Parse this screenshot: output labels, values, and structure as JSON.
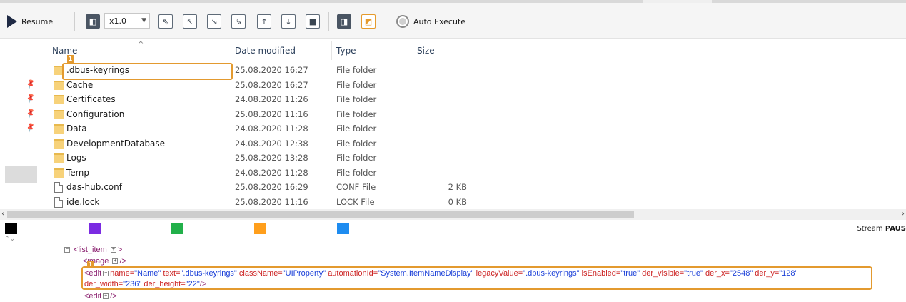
{
  "toolbar": {
    "resume_label": "Resume",
    "speed_value": "x1.0",
    "auto_execute_label": "Auto Execute"
  },
  "explorer": {
    "columns": {
      "name": "Name",
      "date": "Date modified",
      "type": "Type",
      "size": "Size"
    },
    "rows": [
      {
        "name": ".dbus-keyrings",
        "date": "25.08.2020 16:27",
        "type": "File folder",
        "size": "",
        "kind": "folder"
      },
      {
        "name": "Cache",
        "date": "25.08.2020 16:27",
        "type": "File folder",
        "size": "",
        "kind": "folder"
      },
      {
        "name": "Certificates",
        "date": "24.08.2020 11:26",
        "type": "File folder",
        "size": "",
        "kind": "folder"
      },
      {
        "name": "Configuration",
        "date": "25.08.2020 11:16",
        "type": "File folder",
        "size": "",
        "kind": "folder"
      },
      {
        "name": "Data",
        "date": "24.08.2020 11:28",
        "type": "File folder",
        "size": "",
        "kind": "folder"
      },
      {
        "name": "DevelopmentDatabase",
        "date": "24.08.2020 12:38",
        "type": "File folder",
        "size": "",
        "kind": "folder"
      },
      {
        "name": "Logs",
        "date": "25.08.2020 13:28",
        "type": "File folder",
        "size": "",
        "kind": "folder"
      },
      {
        "name": "Temp",
        "date": "24.08.2020 11:28",
        "type": "File folder",
        "size": "",
        "kind": "folder"
      },
      {
        "name": "das-hub.conf",
        "date": "25.08.2020 16:29",
        "type": "CONF File",
        "size": "2 KB",
        "kind": "file"
      },
      {
        "name": "ide.lock",
        "date": "25.08.2020 11:16",
        "type": "LOCK File",
        "size": "0 KB",
        "kind": "file"
      }
    ],
    "highlight_badge": "1"
  },
  "color_strip": {
    "swatches": [
      "#000000",
      "#7b2be2",
      "#22b04a",
      "#ff9f1c",
      "#1e8cf0"
    ],
    "stream_label": "Stream",
    "stream_state": "PAUS"
  },
  "xml": {
    "line1_tag": "<list_item",
    "line1_end": ">",
    "line2_tag": "<image",
    "line2_end": "/>",
    "line3_tag": "<edit",
    "line3_attrs": [
      {
        "n": "name=",
        "v": "\"Name\""
      },
      {
        "n": "text=",
        "v": "\".dbus-keyrings\""
      },
      {
        "n": "className=",
        "v": "\"UIProperty\""
      },
      {
        "n": "automationId=",
        "v": "\"System.ItemNameDisplay\""
      },
      {
        "n": "legacyValue=",
        "v": "\".dbus-keyrings\""
      },
      {
        "n": "isEnabled=",
        "v": "\"true\""
      },
      {
        "n": "der_visible=",
        "v": "\"true\""
      },
      {
        "n": "der_x=",
        "v": "\"2548\""
      },
      {
        "n": "der_y=",
        "v": "\"128\""
      }
    ],
    "line4_attrs": [
      {
        "n": "der_width=",
        "v": "\"236\""
      },
      {
        "n": "der_height=",
        "v": "\"22\""
      }
    ],
    "line4_end": "/>",
    "line5_tag": "<edit",
    "line5_end": "/>",
    "highlight_badge": "1"
  }
}
